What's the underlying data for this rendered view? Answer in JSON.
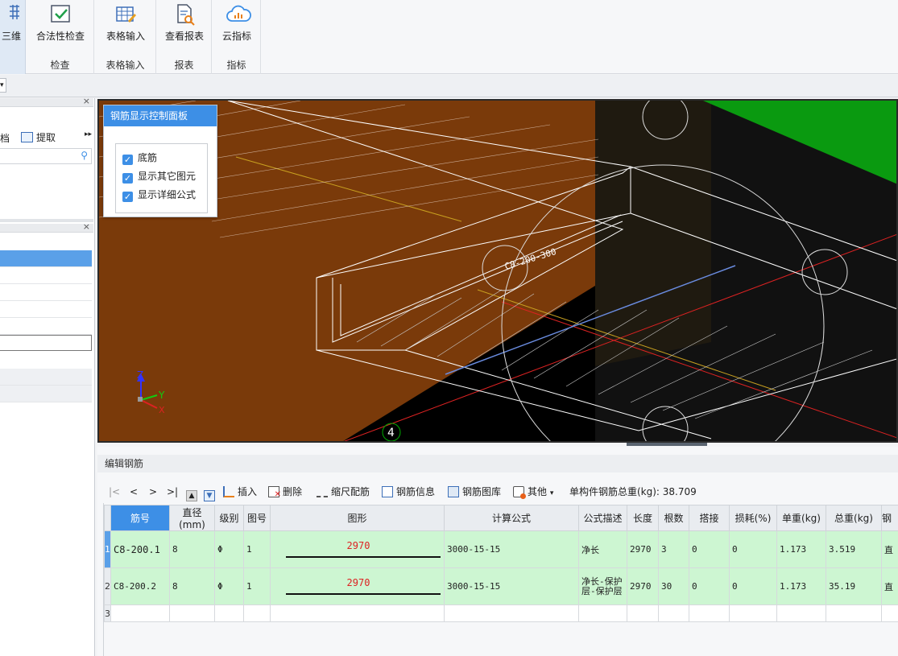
{
  "ribbon": {
    "partial_button": "三维",
    "groups": [
      {
        "label": "检查",
        "buttons": [
          {
            "label": "合法性检查",
            "icon": "check-icon"
          }
        ]
      },
      {
        "label": "表格输入",
        "buttons": [
          {
            "label": "表格输入",
            "icon": "table-edit-icon"
          }
        ]
      },
      {
        "label": "报表",
        "buttons": [
          {
            "label": "查看报表",
            "icon": "report-search-icon"
          }
        ]
      },
      {
        "label": "指标",
        "buttons": [
          {
            "label": "云指标",
            "icon": "cloud-index-icon"
          }
        ]
      }
    ]
  },
  "left_panel": {
    "partial_tab1": "档",
    "extract_label": "提取"
  },
  "viewport": {
    "axis_marker": "4",
    "axes": {
      "z": "Z",
      "y": "Y",
      "x": "X"
    }
  },
  "control_panel": {
    "title": "钢筋显示控制面板",
    "options": [
      {
        "label": "底筋",
        "checked": true
      },
      {
        "label": "显示其它图元",
        "checked": true
      },
      {
        "label": "显示详细公式",
        "checked": true
      }
    ]
  },
  "edit_panel": {
    "title": "编辑钢筋",
    "nav": [
      "|<",
      "<",
      ">",
      ">|"
    ],
    "actions": [
      "插入",
      "删除",
      "缩尺配筋",
      "钢筋信息",
      "钢筋图库",
      "其他"
    ],
    "total_label": "单构件钢筋总重(kg): 38.709"
  },
  "table": {
    "headers": [
      "筋号",
      "直径(mm)",
      "级别",
      "图号",
      "图形",
      "计算公式",
      "公式描述",
      "长度",
      "根数",
      "搭接",
      "损耗(%)",
      "单重(kg)",
      "总重(kg)",
      "钢"
    ],
    "rows": [
      {
        "row_no": "1",
        "bar_no": "C8-200.1",
        "diameter": "8",
        "grade": "Φ",
        "fig_no": "1",
        "shape_len": "2970",
        "formula": "3000-15-15",
        "desc": "净长",
        "length": "2970",
        "count": "3",
        "lap": "0",
        "loss": "0",
        "unit_weight": "1.173",
        "total_weight": "3.519",
        "extra": "直"
      },
      {
        "row_no": "2",
        "bar_no": "C8-200.2",
        "diameter": "8",
        "grade": "Φ",
        "fig_no": "1",
        "shape_len": "2970",
        "formula": "3000-15-15",
        "desc": "净长-保护层-保护层",
        "length": "2970",
        "count": "30",
        "lap": "0",
        "loss": "0",
        "unit_weight": "1.173",
        "total_weight": "35.19",
        "extra": "直"
      },
      {
        "row_no": "3"
      }
    ]
  },
  "colors": {
    "accent": "#3d8fe6",
    "row_green": "#cdf6d2",
    "slab": "#7a3a0a",
    "grass": "#0a9a10"
  }
}
